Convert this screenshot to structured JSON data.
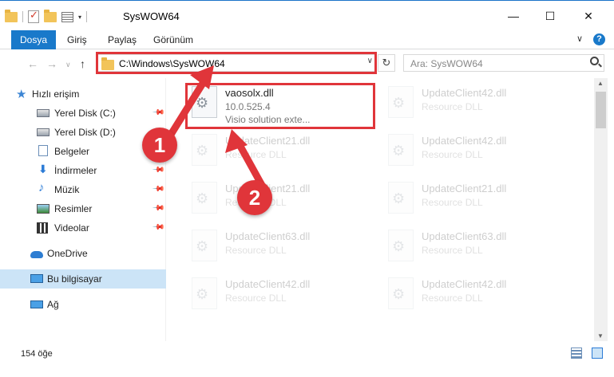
{
  "window": {
    "title": "SysWOW64",
    "minimize": "—",
    "maximize": "☐",
    "close": "✕"
  },
  "ribbon": {
    "tabs": [
      {
        "label": "Dosya"
      },
      {
        "label": "Giriş"
      },
      {
        "label": "Paylaş"
      },
      {
        "label": "Görünüm"
      }
    ],
    "expand": "∨",
    "help": "?"
  },
  "nav": {
    "back": "←",
    "forward": "→",
    "recent": "∨",
    "up": "↑",
    "address": "C:\\Windows\\SysWOW64",
    "address_dropdown": "∨",
    "refresh": "↻",
    "search_placeholder": "Ara: SysWOW64"
  },
  "sidebar": {
    "items": [
      {
        "label": "Hızlı erişim",
        "icon": "star-icon"
      },
      {
        "label": "Yerel Disk (C:)",
        "icon": "drive-icon",
        "pinned": true
      },
      {
        "label": "Yerel Disk (D:)",
        "icon": "drive-icon"
      },
      {
        "label": "Belgeler",
        "icon": "documents-icon"
      },
      {
        "label": "İndirmeler",
        "icon": "downloads-icon",
        "pinned": true
      },
      {
        "label": "Müzik",
        "icon": "music-icon",
        "pinned": true
      },
      {
        "label": "Resimler",
        "icon": "pictures-icon",
        "pinned": true
      },
      {
        "label": "Videolar",
        "icon": "videos-icon",
        "pinned": true
      },
      {
        "label": "OneDrive",
        "icon": "onedrive-icon"
      },
      {
        "label": "Bu bilgisayar",
        "icon": "this-pc-icon",
        "selected": true
      },
      {
        "label": "Ağ",
        "icon": "network-icon"
      }
    ],
    "pin_glyph": "📌"
  },
  "files": [
    {
      "name": "vaosolx.dll",
      "line2": "10.0.525.4",
      "line3": "Visio solution exte...",
      "highlighted": true
    },
    {
      "name": "UpdateClient42.dll",
      "line2": "Resource DLL"
    },
    {
      "name": "UpdateClient21.dll",
      "line2": "Resource DLL"
    },
    {
      "name": "UpdateClient42.dll",
      "line2": "Resource DLL"
    },
    {
      "name": "UpdateClient21.dll",
      "line2": "Resource DLL"
    },
    {
      "name": "UpdateClient21.dll",
      "line2": "Resource DLL"
    },
    {
      "name": "UpdateClient63.dll",
      "line2": "Resource DLL"
    },
    {
      "name": "UpdateClient63.dll",
      "line2": "Resource DLL"
    },
    {
      "name": "UpdateClient42.dll",
      "line2": "Resource DLL"
    },
    {
      "name": "UpdateClient42.dll",
      "line2": "Resource DLL"
    }
  ],
  "status": {
    "item_count": "154 öğe"
  },
  "annotations": {
    "step1": "1",
    "step2": "2",
    "color": "#e0353a"
  }
}
